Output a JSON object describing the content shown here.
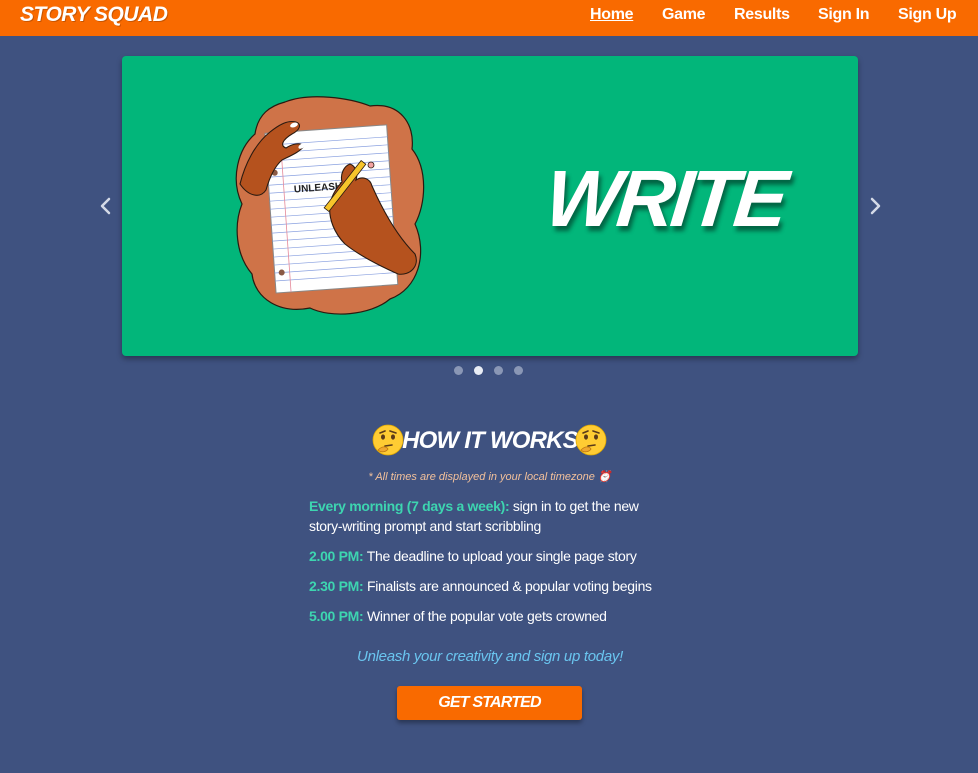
{
  "nav": {
    "brand": "STORY SQUAD",
    "links": [
      "Home",
      "Game",
      "Results",
      "Sign In",
      "Sign Up"
    ],
    "active": "Home"
  },
  "carousel": {
    "slide_title": "WRITE",
    "slide_image": "hands-writing-on-paper-illustration",
    "paper_text": "UNLEASH",
    "slide_count": 4,
    "active_slide": 2,
    "background_color": "#02b67a"
  },
  "how_it_works": {
    "title": "HOW IT WORKS",
    "emoji": "thinking-face-icon",
    "timezone_note": "* All times are displayed in your local timezone ⏰",
    "steps": [
      {
        "time": "Every morning (7 days a week):",
        "text": " sign in to get the new story-writing prompt and start scribbling"
      },
      {
        "time": "2.00 PM:",
        "text": " The deadline to upload your single page story"
      },
      {
        "time": "2.30 PM:",
        "text": " Finalists are announced & popular voting begins"
      },
      {
        "time": "5.00 PM:",
        "text": " Winner of the popular vote gets crowned"
      }
    ],
    "cta_text": "Unleash your creativity and sign up today!",
    "button_label": "GET STARTED"
  },
  "colors": {
    "navbar": "#f96a00",
    "page_background": "#3f5280",
    "accent_teal": "#3dd5b0",
    "cta_blue": "#6ac5ef"
  }
}
